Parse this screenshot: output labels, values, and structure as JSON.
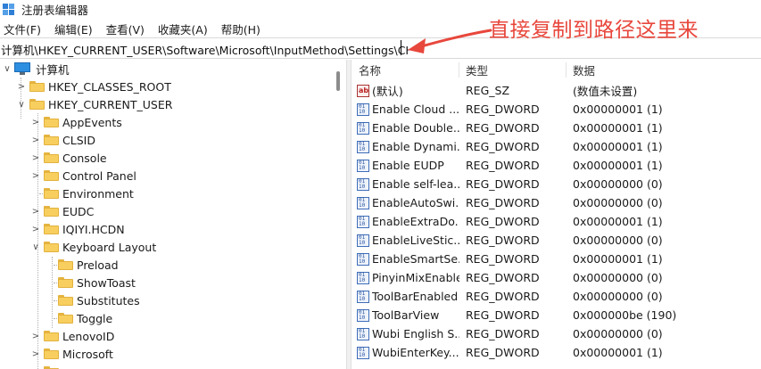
{
  "window": {
    "title": "注册表编辑器"
  },
  "menu": [
    "文件(F)",
    "编辑(E)",
    "查看(V)",
    "收藏夹(A)",
    "帮助(H)"
  ],
  "address": {
    "value": "计算机\\HKEY_CURRENT_USER\\Software\\Microsoft\\InputMethod\\Settings\\CHS"
  },
  "annotation": {
    "text": "直接复制到路径这里来",
    "color": "#e8473c"
  },
  "tree": {
    "items": [
      {
        "label": "计算机"
      },
      {
        "label": "HKEY_CLASSES_ROOT"
      },
      {
        "label": "HKEY_CURRENT_USER"
      },
      {
        "label": "AppEvents"
      },
      {
        "label": "CLSID"
      },
      {
        "label": "Console"
      },
      {
        "label": "Control Panel"
      },
      {
        "label": "Environment"
      },
      {
        "label": "EUDC"
      },
      {
        "label": "IQIYI.HCDN"
      },
      {
        "label": "Keyboard Layout"
      },
      {
        "label": "Preload"
      },
      {
        "label": "ShowToast"
      },
      {
        "label": "Substitutes"
      },
      {
        "label": "Toggle"
      },
      {
        "label": "LenovoID"
      },
      {
        "label": "Microsoft"
      }
    ]
  },
  "list": {
    "columns": [
      "名称",
      "类型",
      "数据"
    ],
    "rows": [
      {
        "name": "(默认)",
        "type": "REG_SZ",
        "data": "(数值未设置)",
        "icon": "string-value-icon"
      },
      {
        "name": "Enable Cloud ...",
        "type": "REG_DWORD",
        "data": "0x00000001 (1)",
        "icon": "dword-value-icon"
      },
      {
        "name": "Enable Double...",
        "type": "REG_DWORD",
        "data": "0x00000001 (1)",
        "icon": "dword-value-icon"
      },
      {
        "name": "Enable Dynami...",
        "type": "REG_DWORD",
        "data": "0x00000001 (1)",
        "icon": "dword-value-icon"
      },
      {
        "name": "Enable EUDP",
        "type": "REG_DWORD",
        "data": "0x00000001 (1)",
        "icon": "dword-value-icon"
      },
      {
        "name": "Enable self-lea...",
        "type": "REG_DWORD",
        "data": "0x00000000 (0)",
        "icon": "dword-value-icon"
      },
      {
        "name": "EnableAutoSwi...",
        "type": "REG_DWORD",
        "data": "0x00000000 (0)",
        "icon": "dword-value-icon"
      },
      {
        "name": "EnableExtraDo...",
        "type": "REG_DWORD",
        "data": "0x00000001 (1)",
        "icon": "dword-value-icon"
      },
      {
        "name": "EnableLiveStic...",
        "type": "REG_DWORD",
        "data": "0x00000000 (0)",
        "icon": "dword-value-icon"
      },
      {
        "name": "EnableSmartSe...",
        "type": "REG_DWORD",
        "data": "0x00000001 (1)",
        "icon": "dword-value-icon"
      },
      {
        "name": "PinyinMixEnable",
        "type": "REG_DWORD",
        "data": "0x00000000 (0)",
        "icon": "dword-value-icon"
      },
      {
        "name": "ToolBarEnabled",
        "type": "REG_DWORD",
        "data": "0x00000000 (0)",
        "icon": "dword-value-icon"
      },
      {
        "name": "ToolBarView",
        "type": "REG_DWORD",
        "data": "0x000000be (190)",
        "icon": "dword-value-icon"
      },
      {
        "name": "Wubi English S...",
        "type": "REG_DWORD",
        "data": "0x00000000 (0)",
        "icon": "dword-value-icon"
      },
      {
        "name": "WubiEnterKey...",
        "type": "REG_DWORD",
        "data": "0x00000001 (1)",
        "icon": "dword-value-icon"
      }
    ]
  }
}
